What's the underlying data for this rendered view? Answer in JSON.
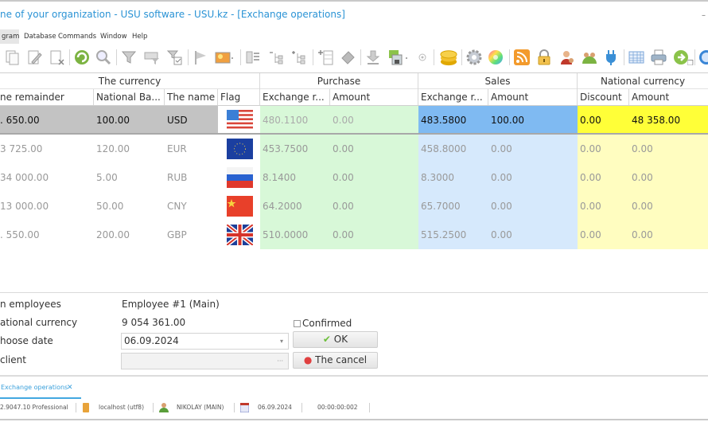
{
  "window": {
    "title": "ne of your organization - USU software - USU.kz - [Exchange operations]",
    "minimize_glyph": "–",
    "restore_glyph": "❐"
  },
  "menu": {
    "items": [
      {
        "label": "gram",
        "active": true
      },
      {
        "label": "Database"
      },
      {
        "label": "Commands"
      },
      {
        "label": "Window"
      },
      {
        "label": "Help"
      }
    ]
  },
  "toolbar": {
    "icons": [
      "copy-icon",
      "edit-icon",
      "delete-icon",
      "refresh-icon",
      "search-icon",
      "filter-icon",
      "filter-columns-icon",
      "filter-check-icon",
      "flag-icon",
      "image-icon",
      "list-icon",
      "tree-collapse-icon",
      "tree-expand-icon",
      "add-row-icon",
      "eraser-icon",
      "download-icon",
      "export-icon",
      "small-circle-icon",
      "coins-icon",
      "gear-icon",
      "color-wheel-icon",
      "rss-icon",
      "lock-icon",
      "user-icon",
      "users-icon",
      "plug-icon",
      "table-icon",
      "printer-icon",
      "next-icon",
      "info-icon"
    ]
  },
  "grid": {
    "bands": [
      "The currency",
      "Purchase",
      "Sales",
      "National currency"
    ],
    "columns": [
      "ne remainder",
      "National Ba...",
      "The name",
      "Flag",
      "Exchange r...",
      "Amount",
      "Exchange r...",
      "Amount",
      "Discount",
      "Amount"
    ],
    "colors": {
      "purchase_bg": "#d8f8d8",
      "sales_bg": "#d6e9fc",
      "national_bg": "#fffdc0",
      "selected_row_bg": "#c3c3c3",
      "selected_sales_bg": "#7fbaf2",
      "selected_national_bg": "#ffff38"
    },
    "rows": [
      {
        "remainder": ". 650.00",
        "national_bank": "100.00",
        "name": "USD",
        "flag": "us-flag-icon",
        "purchase_rate": "480.1100",
        "purchase_amount": "0.00",
        "sales_rate": "483.5800",
        "sales_amount": "100.00",
        "discount": "0.00",
        "national_amount": "48 358.00",
        "selected": true
      },
      {
        "remainder": "3 725.00",
        "national_bank": "120.00",
        "name": "EUR",
        "flag": "eu-flag-icon",
        "purchase_rate": "453.7500",
        "purchase_amount": "0.00",
        "sales_rate": "458.8000",
        "sales_amount": "0.00",
        "discount": "0.00",
        "national_amount": "0.00"
      },
      {
        "remainder": "34 000.00",
        "national_bank": "5.00",
        "name": "RUB",
        "flag": "ru-flag-icon",
        "purchase_rate": "8.1400",
        "purchase_amount": "0.00",
        "sales_rate": "8.3000",
        "sales_amount": "0.00",
        "discount": "0.00",
        "national_amount": "0.00"
      },
      {
        "remainder": "13 000.00",
        "national_bank": "50.00",
        "name": "CNY",
        "flag": "cn-flag-icon",
        "purchase_rate": "64.2000",
        "purchase_amount": "0.00",
        "sales_rate": "65.7000",
        "sales_amount": "0.00",
        "discount": "0.00",
        "national_amount": "0.00"
      },
      {
        "remainder": ". 550.00",
        "national_bank": "200.00",
        "name": "GBP",
        "flag": "gb-flag-icon",
        "purchase_rate": "510.0000",
        "purchase_amount": "0.00",
        "sales_rate": "515.2500",
        "sales_amount": "0.00",
        "discount": "0.00",
        "national_amount": "0.00"
      }
    ]
  },
  "form": {
    "employees_label": "n employees",
    "employees_value": "Employee #1 (Main)",
    "national_currency_label": "ational currency",
    "national_currency_value": "9 054 361.00",
    "date_label": "hoose date",
    "date_value": "06.09.2024",
    "client_label": "client",
    "client_value": "",
    "confirmed_label": "Confirmed",
    "confirmed_checked": false,
    "ok_label": "OK",
    "cancel_label": "The cancel"
  },
  "tabs": [
    {
      "label": "Exchange operations",
      "close": "✕"
    }
  ],
  "status": {
    "version": "2.9047.10 Professional",
    "db": "localhost (utf8)",
    "user": "NIKOLAY (MAIN)",
    "date": "06.09.2024",
    "timer": "00:00:00:002"
  }
}
